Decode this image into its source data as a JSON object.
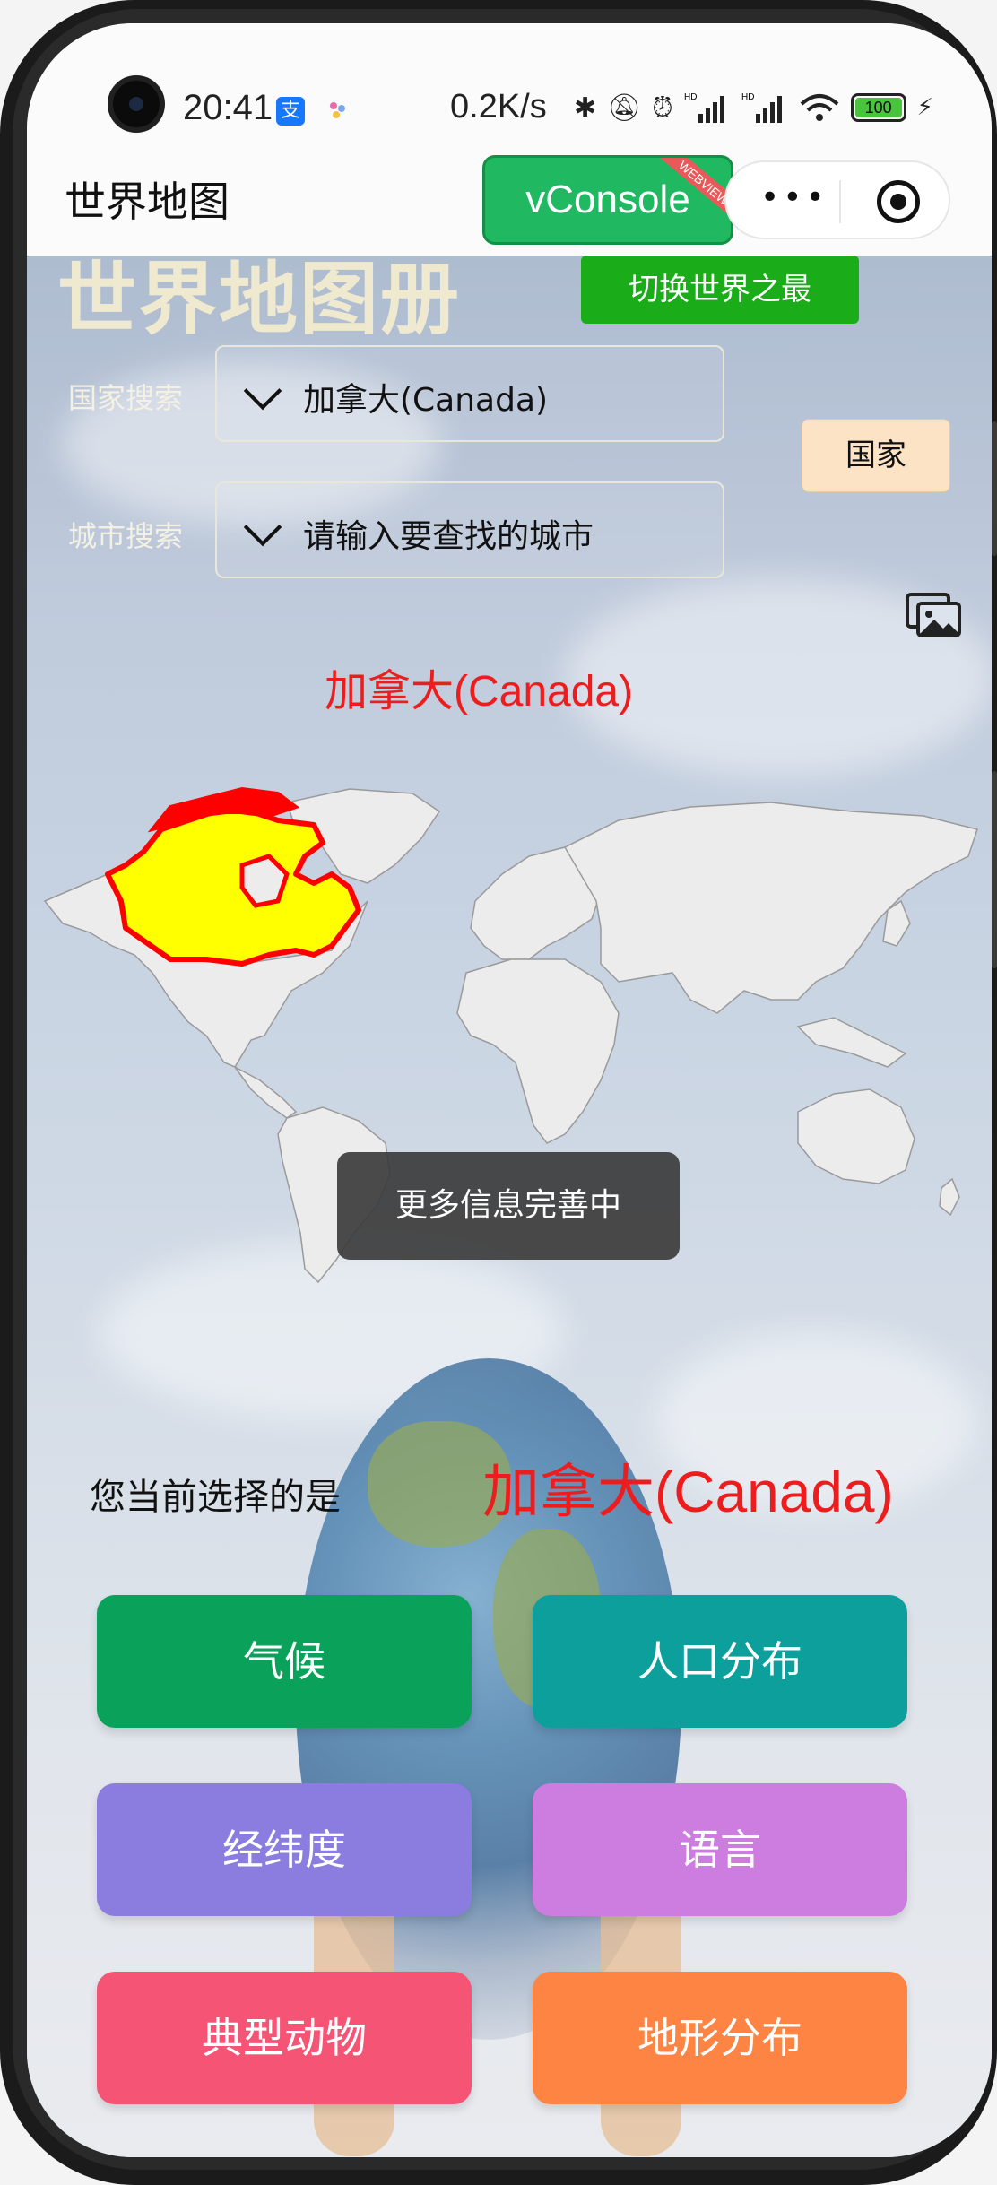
{
  "status_bar": {
    "time": "20:41",
    "speed": "0.2K/s",
    "battery": "100",
    "hd1": "HD",
    "hd2": "HD"
  },
  "header": {
    "title": "世界地图",
    "vconsole_label": "vConsole",
    "vconsole_ribbon": "WEBVIEW"
  },
  "main": {
    "big_title": "世界地图册",
    "switch_button": "切换世界之最",
    "country_search": {
      "label": "国家搜索",
      "value": "加拿大(Canada)"
    },
    "city_search": {
      "label": "城市搜索",
      "placeholder": "请输入要查找的城市"
    },
    "country_button": "国家",
    "map_title": "加拿大(Canada)",
    "toast": "更多信息完善中",
    "selected_label": "您当前选择的是",
    "selected_value": "加拿大(Canada)",
    "topics": [
      {
        "label": "气候",
        "color": "#0aa15a"
      },
      {
        "label": "人口分布",
        "color": "#0c9f9c"
      },
      {
        "label": "经纬度",
        "color": "#8b7ddf"
      },
      {
        "label": "语言",
        "color": "#cc7ddf"
      },
      {
        "label": "典型动物",
        "color": "#f55475"
      },
      {
        "label": "地形分布",
        "color": "#fd8442"
      }
    ]
  },
  "colors": {
    "highlight_fill": "#ffff00",
    "highlight_border": "#ff0000",
    "land": "#ececec"
  }
}
